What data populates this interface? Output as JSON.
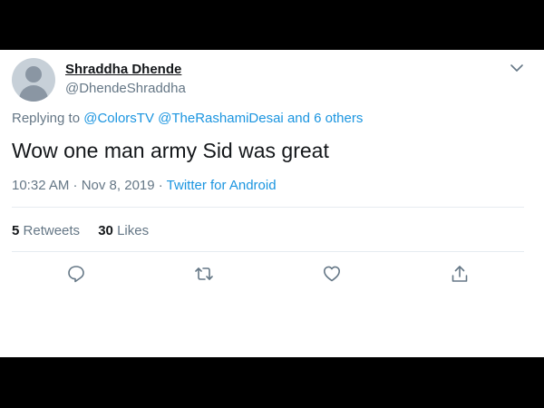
{
  "tweet": {
    "display_name": "Shraddha Dhende",
    "handle": "@DhendeShraddha",
    "replying_prefix": "Replying to",
    "reply_mentions": [
      "@ColorsTV",
      "@TheRashamiDesai"
    ],
    "reply_others": "and 6 others",
    "text": "Wow one man army Sid was great",
    "time": "10:32 AM · Nov 8, 2019 · ",
    "source": "Twitter for Android",
    "retweets_count": "5",
    "retweets_label": "Retweets",
    "likes_count": "30",
    "likes_label": "Likes"
  },
  "icons": {
    "menu": "chevron-down-icon",
    "reply": "reply-icon",
    "retweet": "retweet-icon",
    "like": "heart-icon",
    "share": "share-icon"
  },
  "colors": {
    "link": "#1b95e0",
    "secondary_text": "#657786",
    "primary_text": "#14171a",
    "divider": "#e6ecf0",
    "background": "#ffffff"
  }
}
